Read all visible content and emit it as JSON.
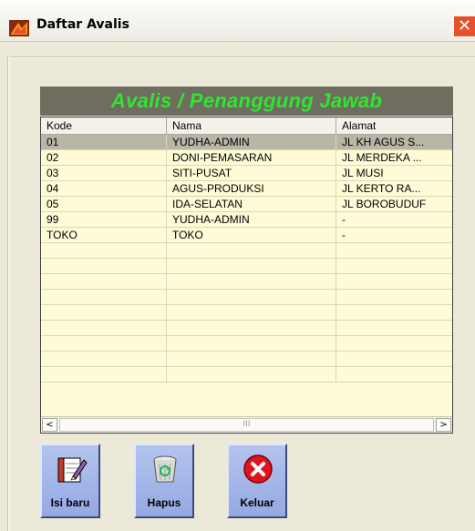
{
  "window": {
    "title": "Daftar Avalis",
    "close_glyph": "✕"
  },
  "panel": {
    "header": "Avalis / Penanggung Jawab"
  },
  "table": {
    "columns": [
      "Kode",
      "Nama",
      "Alamat"
    ],
    "rows": [
      [
        "01",
        "YUDHA-ADMIN",
        "JL KH AGUS S..."
      ],
      [
        "02",
        "DONI-PEMASARAN",
        "JL MERDEKA ..."
      ],
      [
        "03",
        "SITI-PUSAT",
        "JL MUSI"
      ],
      [
        "04",
        "AGUS-PRODUKSI",
        "JL KERTO RA..."
      ],
      [
        "05",
        "IDA-SELATAN",
        "JL BOROBUDUF"
      ],
      [
        "99",
        "YUDHA-ADMIN",
        "-"
      ],
      [
        "TOKO",
        "TOKO",
        "-"
      ]
    ],
    "selected_row": 0,
    "empty_rows": 9
  },
  "scrollbar": {
    "left_arrow": "<",
    "right_arrow": ">",
    "thumb_grip": "III"
  },
  "buttons": {
    "new_label": "Isi baru",
    "delete_label": "Hapus",
    "exit_label": "Keluar",
    "new_icon": "notebook-pencil-icon",
    "delete_icon": "recycle-bin-icon",
    "exit_icon": "red-x-icon"
  },
  "colors": {
    "header_text": "#2ee62e",
    "grid_bg": "#fffbd6",
    "button_bg": "#a6b8e8"
  }
}
